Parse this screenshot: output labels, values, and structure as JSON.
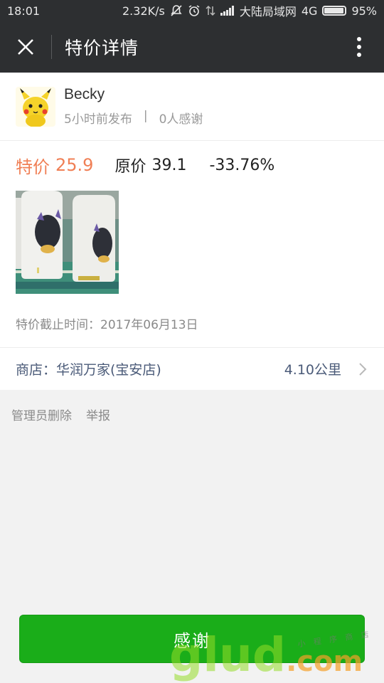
{
  "status_bar": {
    "time": "18:01",
    "speed": "2.32K/s",
    "carrier": "大陆局域网",
    "network": "4G",
    "battery": "95%",
    "battery_level": 0.95
  },
  "nav": {
    "title": "特价详情"
  },
  "post": {
    "user_name": "Becky",
    "posted_time": "5小时前发布",
    "separator": "|",
    "thanks_count": "0人感谢"
  },
  "price": {
    "special_label": "特价",
    "special_value": "25.9",
    "original_label": "原价",
    "original_value": "39.1",
    "discount": "-33.76%"
  },
  "deadline": {
    "label": "特价截止时间：",
    "value": "2017年06月13日"
  },
  "store": {
    "label": "商店：",
    "name": "华润万家(宝安店)",
    "distance": "4.10公里"
  },
  "admin": {
    "delete_label": "管理员删除",
    "report_label": "举报"
  },
  "action": {
    "thanks_label": "感谢"
  },
  "watermark": {
    "main": "glud",
    "suffix": ".com",
    "small": "小 程 序 商 店"
  },
  "colors": {
    "header_bg": "#2d2f31",
    "special_price": "#f07f55",
    "store_text": "#4a5a78",
    "button_green": "#1aad19"
  },
  "icons": {
    "close": "close-icon",
    "more": "more-vertical-icon",
    "chevron": "chevron-right-icon",
    "mute": "mute-icon",
    "alarm": "alarm-icon",
    "signal": "signal-icon",
    "battery": "battery-icon"
  }
}
